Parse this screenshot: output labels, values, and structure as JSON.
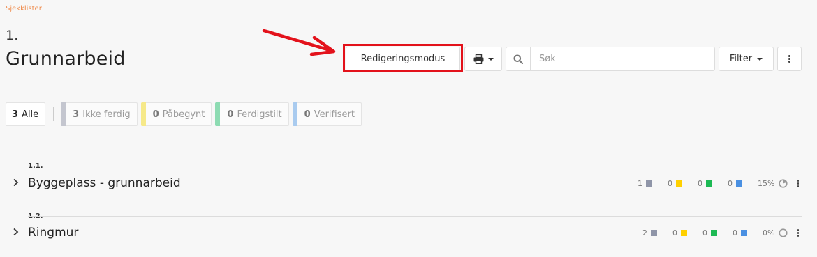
{
  "breadcrumb": "Sjekklister",
  "header": {
    "number": "1.",
    "title": "Grunnarbeid"
  },
  "toolbar": {
    "edit_label": "Redigeringsmodus",
    "search_placeholder": "Søk",
    "filter_label": "Filter"
  },
  "status_tabs": [
    {
      "count": "3",
      "label": "Alle",
      "color": ""
    },
    {
      "count": "3",
      "label": "Ikke ferdig",
      "color": "#c4c6cf"
    },
    {
      "count": "0",
      "label": "Påbegynt",
      "color": "#f6e989"
    },
    {
      "count": "0",
      "label": "Ferdigstilt",
      "color": "#8ddbb2"
    },
    {
      "count": "0",
      "label": "Verifisert",
      "color": "#a9cbef"
    }
  ],
  "status_colors": {
    "not_done": "#8f95a8",
    "started": "#ffd000",
    "done": "#1db954",
    "verified": "#4a90e2"
  },
  "sections": [
    {
      "number": "1.1.",
      "title": "Byggeplass - grunnarbeid",
      "not_done": "1",
      "started": "0",
      "done": "0",
      "verified": "0",
      "percent": "15%",
      "progress": 0.15
    },
    {
      "number": "1.2.",
      "title": "Ringmur",
      "not_done": "2",
      "started": "0",
      "done": "0",
      "verified": "0",
      "percent": "0%",
      "progress": 0
    }
  ]
}
